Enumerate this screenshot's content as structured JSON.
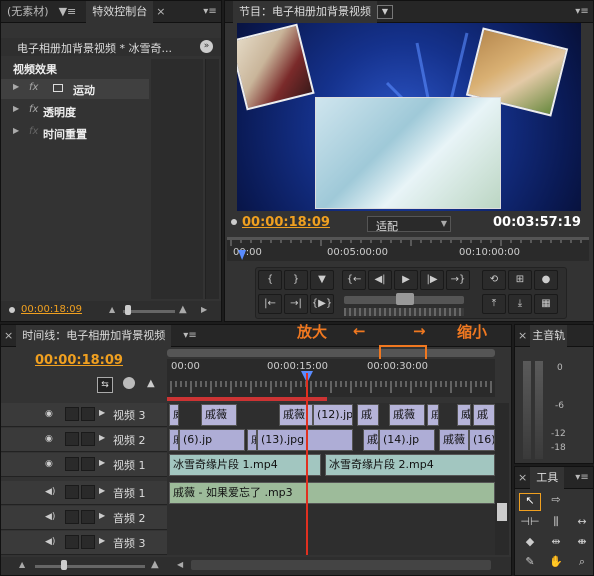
{
  "source_panel": {
    "tabs": [
      "(无素材)",
      "特效控制台"
    ],
    "clip_title": "电子相册加背景视频 * 冰雪奇...",
    "section_title": "视频效果",
    "effects": [
      {
        "fx": "fx",
        "label": "运动"
      },
      {
        "fx": "fx",
        "label": "透明度"
      },
      {
        "fx": "fx",
        "label": "时间重置"
      }
    ],
    "timecode": "00:00:18:09"
  },
  "program_monitor": {
    "title": "节目：电子相册加背景视频",
    "timecode_current": "00:00:18:09",
    "fit_label": "适配",
    "timecode_duration": "00:03:57:19",
    "ruler_labels": [
      "00:00",
      "00:05:00:00",
      "00:10:00:00"
    ],
    "playhead_fraction": 0.02
  },
  "timeline": {
    "title": "时间线：电子相册加背景视频",
    "timecode": "00:00:18:09",
    "ruler_labels": [
      "00:00",
      "00:00:15:00",
      "00:00:30:00"
    ],
    "annotation_zoom_in": "放大",
    "annotation_zoom_out": "缩小",
    "annotation_left_arrow": "←",
    "annotation_right_arrow": "→",
    "tracks": [
      {
        "name": "视频 3",
        "type": "video"
      },
      {
        "name": "视频 2",
        "type": "video"
      },
      {
        "name": "视频 1",
        "type": "video"
      },
      {
        "name": "音频 1",
        "type": "audio"
      },
      {
        "name": "音频 2",
        "type": "audio"
      },
      {
        "name": "音频 3",
        "type": "audio"
      }
    ],
    "clips_v3": [
      "威",
      "戚薇",
      "戚薇",
      "(12).jp",
      "戚",
      "戚薇",
      "戚",
      "威",
      "戚"
    ],
    "clips_v2": [
      "戚薇",
      "(6).jp",
      "戚薇",
      "(13).jpg",
      "戚薇",
      "(14).jp",
      "戚薇",
      "(16)"
    ],
    "clips_v1": [
      "冰雪奇缘片段 1.mp4",
      "冰雪奇缘片段 2.mp4"
    ],
    "clips_a1": [
      "戚薇 - 如果爱忘了 .mp3"
    ]
  },
  "audio_master": {
    "title": "主音轨",
    "scale": [
      "0",
      "-6",
      "-12",
      "-18"
    ]
  },
  "tools": {
    "title": "工具"
  },
  "colors": {
    "accent_orange": "#f0a020",
    "playhead_red": "#e03020",
    "panel_bg": "#333333"
  }
}
